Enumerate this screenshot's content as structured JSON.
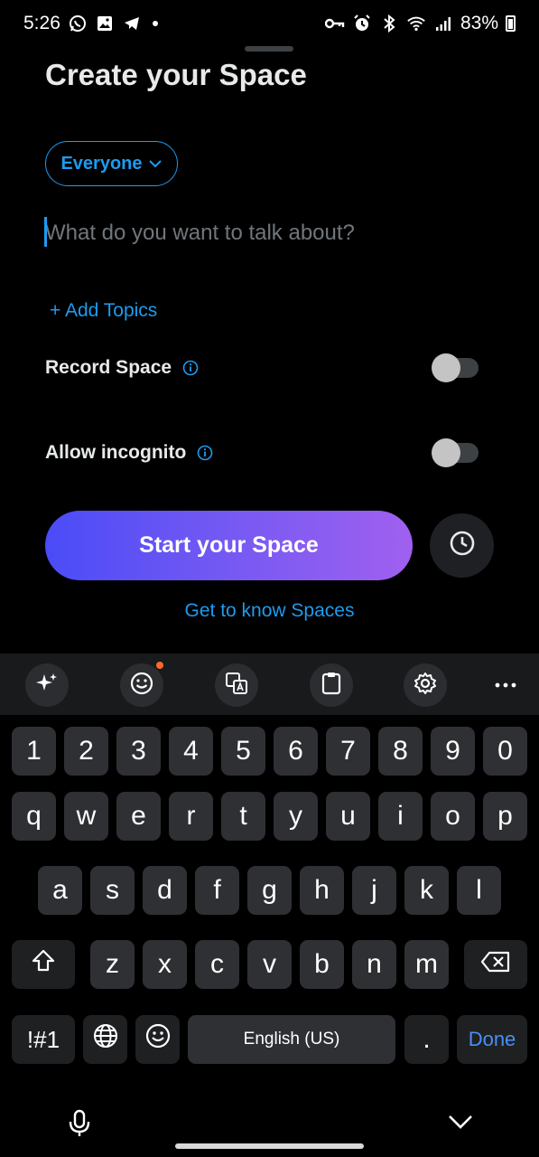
{
  "status_bar": {
    "time": "5:26",
    "battery": "83%"
  },
  "sheet": {
    "title": "Create your Space",
    "audience": "Everyone",
    "topic_placeholder": "What do you want to talk about?",
    "topic_value": "",
    "add_topics": "+ Add Topics",
    "record_space": {
      "label": "Record Space",
      "enabled": false
    },
    "allow_incognito": {
      "label": "Allow incognito",
      "enabled": false
    },
    "start_button": "Start your Space",
    "get_to_know": "Get to know Spaces"
  },
  "colors": {
    "accent": "#1d9bf0",
    "gradient_start": "#4a4cf7",
    "gradient_end": "#a060f0",
    "notification_dot": "#ff6a2a"
  },
  "keyboard": {
    "toolbar_icons": [
      "ai-sparkle-icon",
      "emoji-icon",
      "translate-icon",
      "clipboard-icon",
      "settings-icon",
      "more-icon"
    ],
    "number_row": [
      "1",
      "2",
      "3",
      "4",
      "5",
      "6",
      "7",
      "8",
      "9",
      "0"
    ],
    "row1": [
      "q",
      "w",
      "e",
      "r",
      "t",
      "y",
      "u",
      "i",
      "o",
      "p"
    ],
    "row2": [
      "a",
      "s",
      "d",
      "f",
      "g",
      "h",
      "j",
      "k",
      "l"
    ],
    "row3": [
      "z",
      "x",
      "c",
      "v",
      "b",
      "n",
      "m"
    ],
    "symbols_key": "!#1",
    "space_label": "English (US)",
    "period_key": ".",
    "done_key": "Done"
  }
}
